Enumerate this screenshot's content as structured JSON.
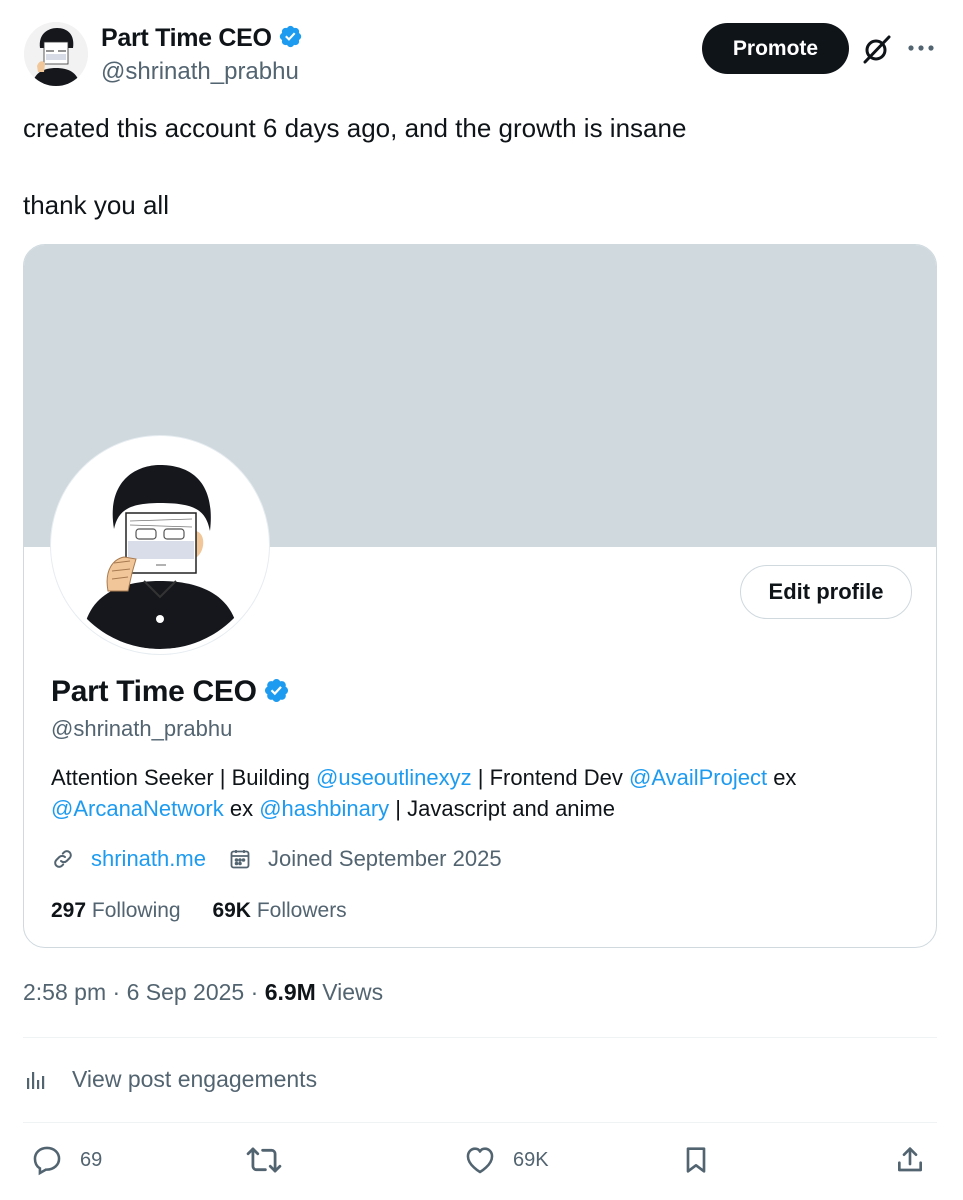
{
  "author": {
    "name": "Part Time CEO",
    "handle": "@shrinath_prabhu"
  },
  "header": {
    "promote_label": "Promote"
  },
  "tweet": {
    "line1": "created this account 6 days ago, and the growth is insane",
    "line2": "thank you all"
  },
  "profile_card": {
    "edit_label": "Edit profile",
    "name": "Part Time CEO",
    "handle": "@shrinath_prabhu",
    "bio": {
      "t1": "Attention Seeker | Building ",
      "m1": "@useoutlinexyz",
      "t2": " | Frontend Dev ",
      "m2": "@AvailProject",
      "t3": " ex",
      "m3": "@ArcanaNetwork",
      "t4": " ex ",
      "m4": "@hashbinary",
      "t5": " | Javascript and anime"
    },
    "website": "shrinath.me",
    "joined": "Joined September 2025",
    "following_count": "297",
    "following_label": "Following",
    "followers_count": "69K",
    "followers_label": "Followers"
  },
  "meta": {
    "time": "2:58 pm",
    "date": "6 Sep 2025",
    "views_count": "6.9M",
    "views_label": "Views"
  },
  "engagements_label": "View post engagements",
  "actions": {
    "replies": "69",
    "likes": "69K"
  },
  "colors": {
    "accent": "#1d9bf0",
    "text": "#0f1419",
    "muted": "#536471",
    "border": "#cfd9de",
    "banner": "#cfd9de"
  },
  "icons": [
    "verified-badge-icon",
    "grok-icon",
    "more-icon",
    "link-icon",
    "calendar-icon",
    "analytics-icon",
    "reply-icon",
    "repost-icon",
    "like-icon",
    "bookmark-icon",
    "share-icon"
  ]
}
